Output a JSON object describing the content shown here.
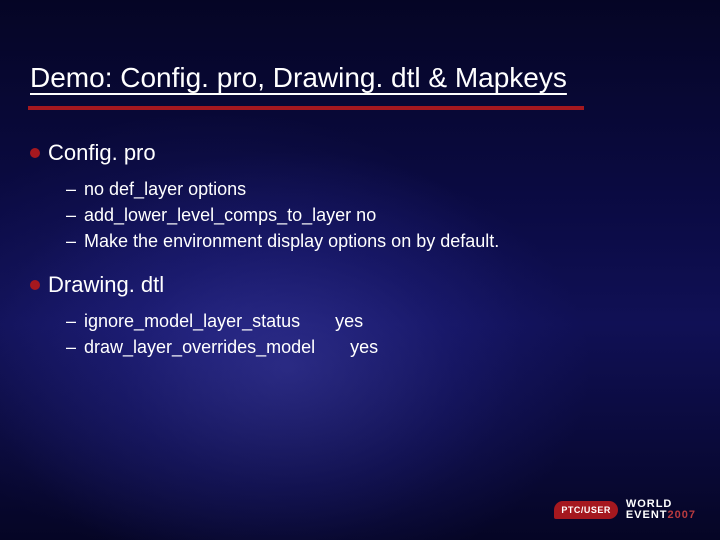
{
  "title": "Demo: Config. pro, Drawing. dtl & Mapkeys",
  "sections": [
    {
      "heading": "Config. pro",
      "items": [
        "no def_layer options",
        "add_lower_level_comps_to_layer no",
        "Make the environment display options on by default."
      ]
    },
    {
      "heading": "Drawing. dtl",
      "items": [
        "ignore_model_layer_status       yes",
        "draw_layer_overrides_model       yes"
      ]
    }
  ],
  "footer": {
    "badge": "PTC/USER",
    "line1": "WORLD",
    "line2": "EVENT",
    "year": "2007"
  }
}
